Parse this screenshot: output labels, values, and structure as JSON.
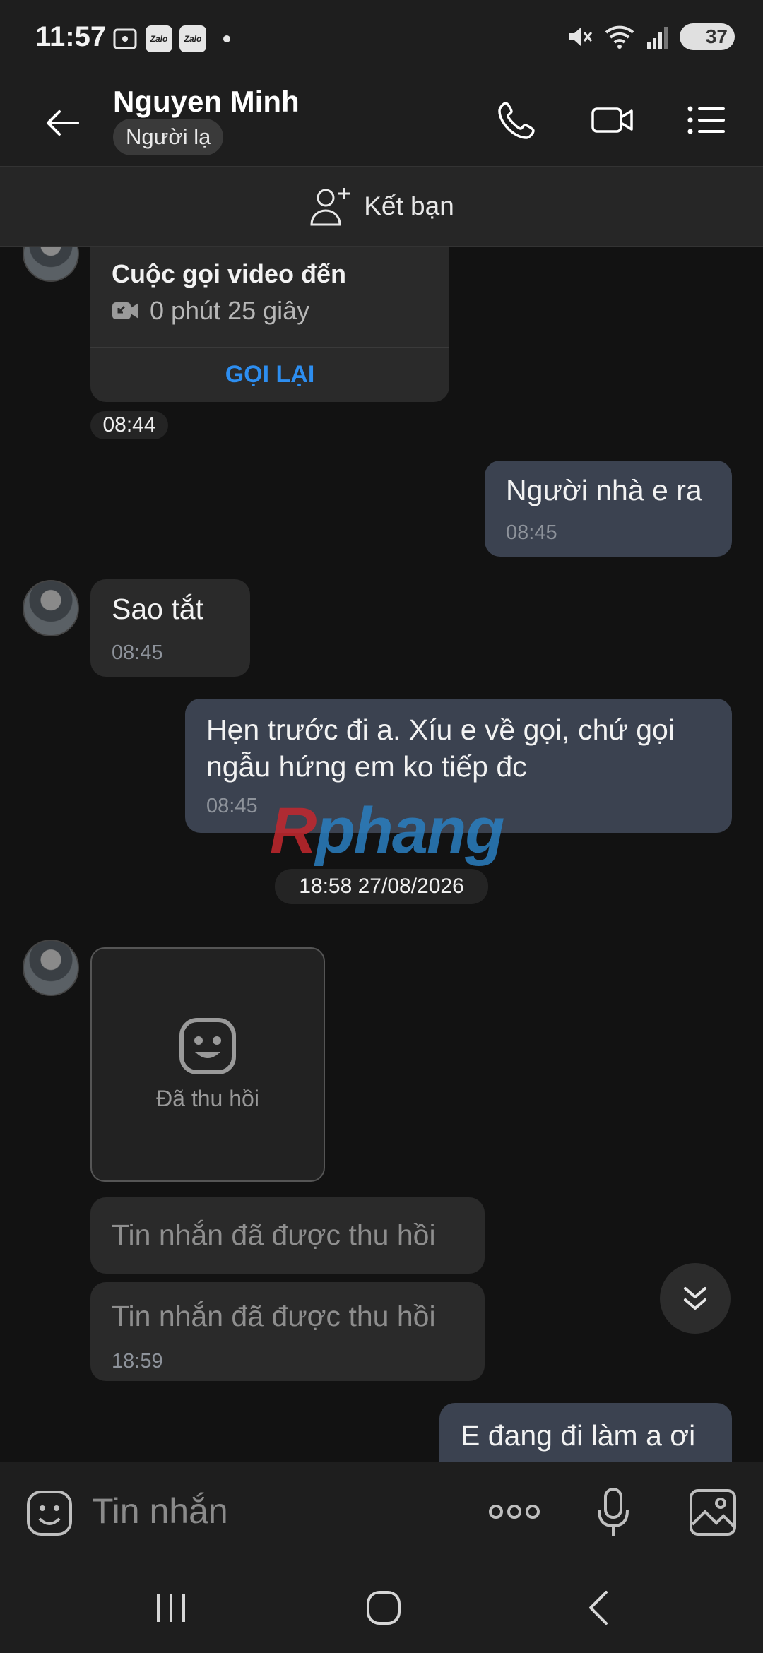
{
  "status_bar": {
    "time": "11:57",
    "battery": "37",
    "app_icons": [
      "Zalo",
      "Zalo"
    ]
  },
  "header": {
    "contact_name": "Nguyen Minh",
    "badge": "Người lạ"
  },
  "add_friend": {
    "label": "Kết bạn"
  },
  "messages": {
    "call_card": {
      "title": "Cuộc gọi video đến",
      "duration": "0 phút 25 giây",
      "action": "GỌI LẠI",
      "time": "08:44"
    },
    "out_1": {
      "text": "Người nhà e ra",
      "time": "08:45"
    },
    "in_1": {
      "text": "Sao tắt",
      "time": "08:45"
    },
    "out_2": {
      "text": "Hẹn trước đi a. Xíu e về gọi, chứ gọi ngẫu hứng em ko tiếp đc",
      "time": "08:45"
    },
    "date_separator": "18:58 27/08/2026",
    "recalled_media": "Đã thu hồi",
    "recalled_1": "Tin nhắn đã được thu hồi",
    "recalled_2": {
      "text": "Tin nhắn đã được thu hồi",
      "time": "18:59"
    },
    "out_3": {
      "text": "E đang đi làm a ơi"
    }
  },
  "watermark": {
    "first": "R",
    "rest": "phang"
  },
  "input": {
    "placeholder": "Tin nhắn"
  },
  "colors": {
    "accent_link": "#2d8ef0",
    "outgoing_bubble": "#3b4250",
    "incoming_bubble": "#2a2a2a",
    "background": "#121212"
  }
}
